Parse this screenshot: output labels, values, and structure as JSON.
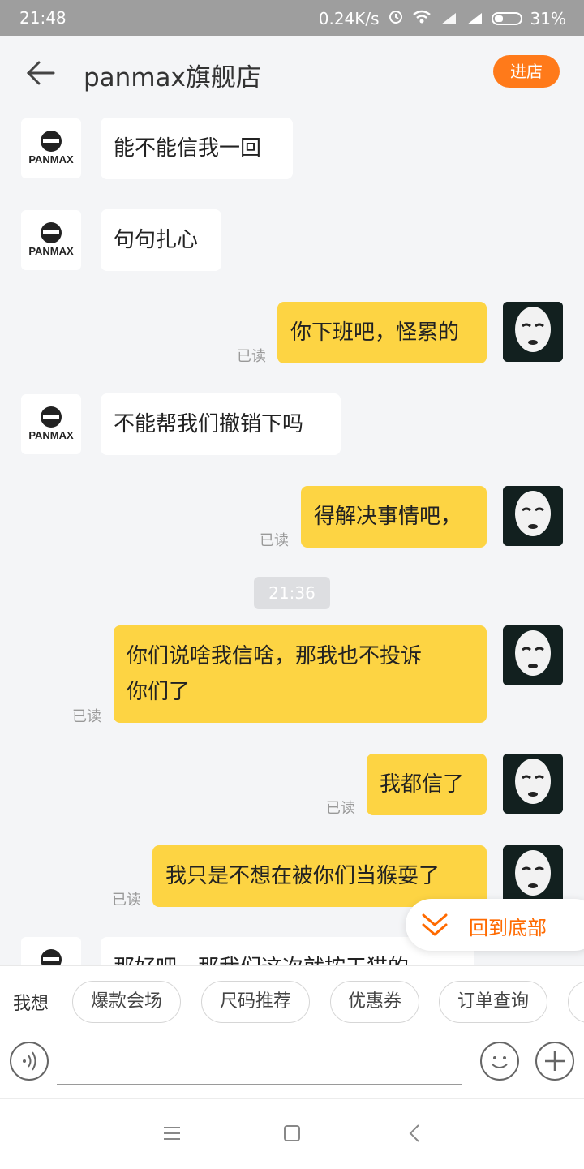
{
  "status_bar": {
    "time": "21:48",
    "network_speed": "0.24K/s",
    "battery": "31%",
    "icons": [
      "alarm-icon",
      "wifi-icon",
      "signal-icon",
      "signal-icon",
      "battery-icon"
    ]
  },
  "header": {
    "title": "panmax旗舰店",
    "enter_store_label": "进店"
  },
  "shop_logo_text": "PANMAX",
  "messages": [
    {
      "side": "left",
      "text": "能不能信我一回"
    },
    {
      "side": "left",
      "text": "句句扎心"
    },
    {
      "side": "right",
      "text": "你下班吧，怪累的",
      "status": "已读"
    },
    {
      "side": "left",
      "text": "不能帮我们撤销下吗"
    },
    {
      "side": "right",
      "text": "得解决事情吧，",
      "status": "已读"
    },
    {
      "side": "time",
      "text": "21:36"
    },
    {
      "side": "right",
      "text_line1": "你们说啥我信啥，那我也不投诉",
      "text_line2": "你们了",
      "status": "已读"
    },
    {
      "side": "right",
      "text": "我都信了",
      "status": "已读"
    },
    {
      "side": "right",
      "text": "我只是不想在被你们当猴耍了",
      "status": "已读"
    },
    {
      "side": "left",
      "text": "那好吧，那我们这次就按天猫的"
    }
  ],
  "back_to_bottom": "回到底部",
  "quick_bar": {
    "label": "我想",
    "chips": [
      "爆款会场",
      "尺码推荐",
      "优惠券",
      "订单查询"
    ]
  },
  "colors": {
    "accent": "#ff7a1a",
    "my_bubble": "#fdd443",
    "their_bubble": "#ffffff",
    "background": "#f4f5f7"
  }
}
